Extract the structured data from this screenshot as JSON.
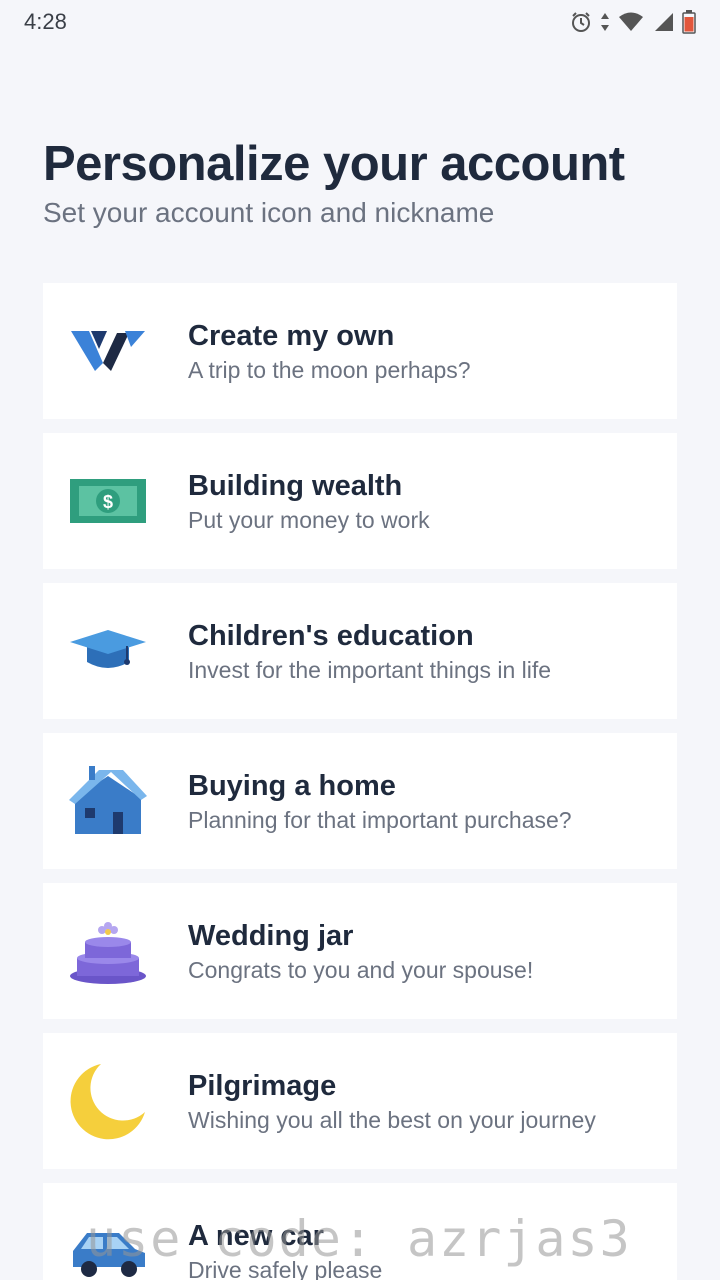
{
  "status_bar": {
    "time": "4:28",
    "icons": [
      "alarm-icon",
      "data-arrows-icon",
      "wifi-icon",
      "signal-icon",
      "battery-icon"
    ]
  },
  "header": {
    "title": "Personalize your account",
    "subtitle": "Set your account icon and nickname"
  },
  "goals": [
    {
      "title": "Create my own",
      "description": "A trip to the moon perhaps?",
      "icon": "logo-icon"
    },
    {
      "title": "Building wealth",
      "description": "Put your money to work",
      "icon": "money-icon"
    },
    {
      "title": "Children's education",
      "description": "Invest for the important things in life",
      "icon": "graduation-cap-icon"
    },
    {
      "title": "Buying a home",
      "description": "Planning for that important purchase?",
      "icon": "house-icon"
    },
    {
      "title": "Wedding jar",
      "description": "Congrats to you and your spouse!",
      "icon": "cake-icon"
    },
    {
      "title": "Pilgrimage",
      "description": "Wishing you all the best on your journey",
      "icon": "crescent-moon-icon"
    },
    {
      "title": "A new car",
      "description": "Drive safely please",
      "icon": "car-icon"
    }
  ],
  "watermark": "use code: azrjas3",
  "colors": {
    "background": "#f5f6fa",
    "card": "#ffffff",
    "title": "#1f2a3d",
    "subtitle": "#6b7280"
  }
}
